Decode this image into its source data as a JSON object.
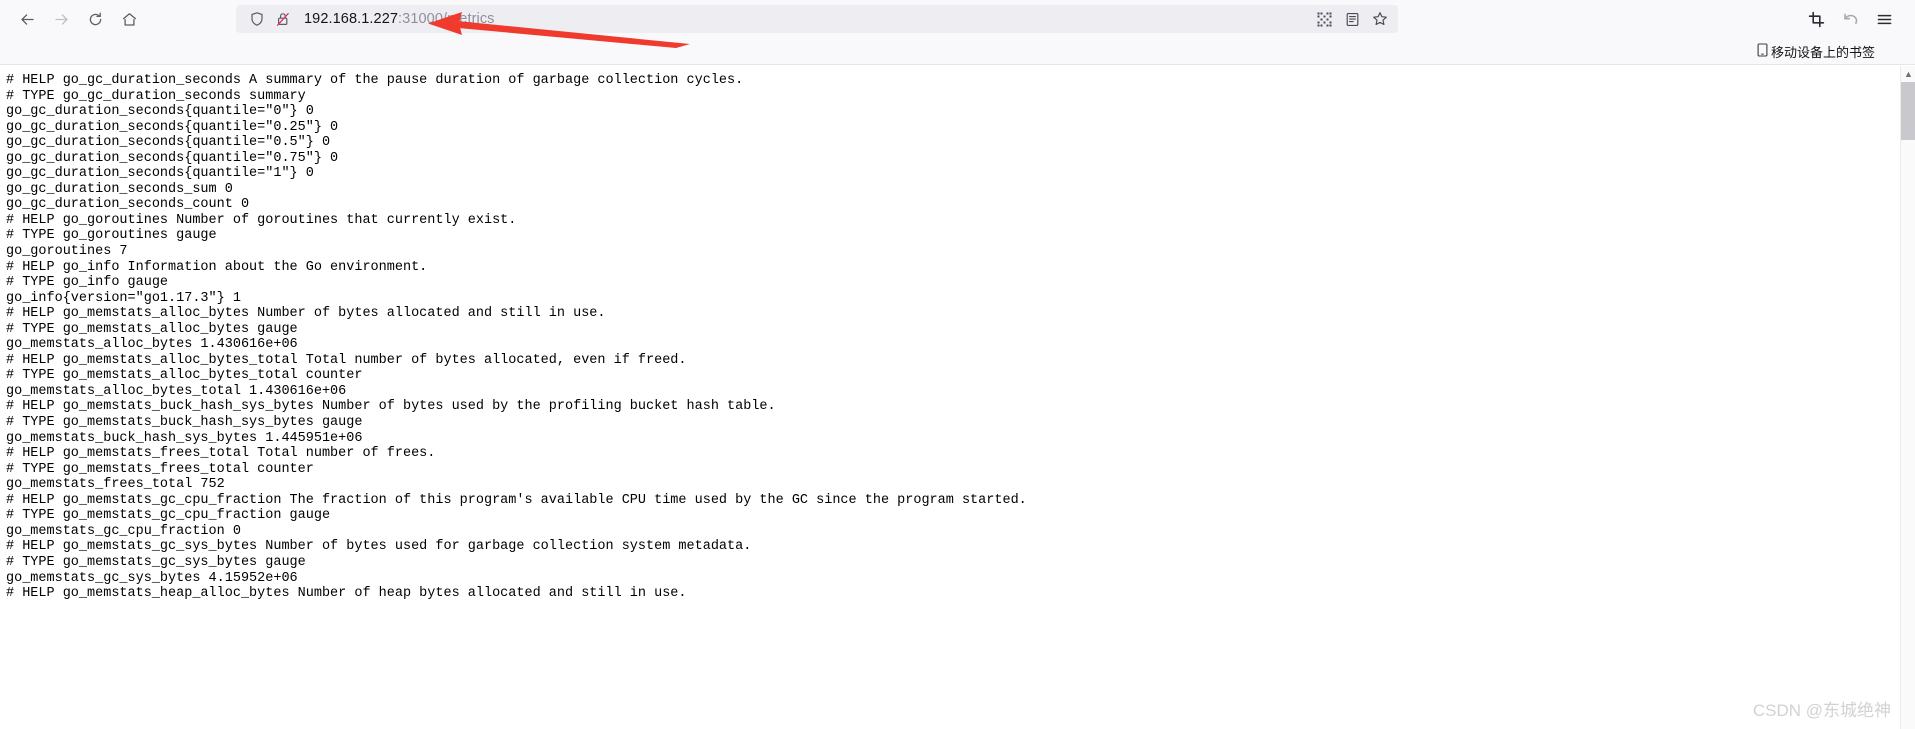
{
  "browser": {
    "back_label": "Back",
    "forward_label": "Forward",
    "reload_label": "Reload",
    "home_label": "Home",
    "url": {
      "host": "192.168.1.227",
      "rest": ":31000/metrics",
      "full": "192.168.1.227:31000/metrics",
      "shield_label": "Enhanced tracking protection",
      "lock_label": "Connection is not secure"
    },
    "url_actions": [
      {
        "name": "qr-code-icon",
        "label": "QR code"
      },
      {
        "name": "reader-mode-icon",
        "label": "Reader view"
      },
      {
        "name": "bookmark-star-icon",
        "label": "Bookmark this page"
      }
    ],
    "toolbar_right": [
      {
        "name": "screenshot-icon",
        "label": "Screenshot"
      },
      {
        "name": "undo-icon",
        "label": "Undo"
      },
      {
        "name": "menu-icon",
        "label": "Open application menu"
      }
    ]
  },
  "bookmarks_bar": {
    "items": [
      {
        "label": "移动设备上的书签",
        "icon": "mobile-device-icon"
      }
    ]
  },
  "scrollbar": {
    "up_arrow": "▲",
    "thumb_label": "Vertical scrollbar thumb"
  },
  "watermark": {
    "text": "CSDN @东城绝神"
  },
  "annotation": {
    "color": "#ef3b2d",
    "label": "Red arrow pointing at address bar URL"
  },
  "page": {
    "content_type": "prometheus-metrics-plaintext",
    "text": "# HELP go_gc_duration_seconds A summary of the pause duration of garbage collection cycles.\n# TYPE go_gc_duration_seconds summary\ngo_gc_duration_seconds{quantile=\"0\"} 0\ngo_gc_duration_seconds{quantile=\"0.25\"} 0\ngo_gc_duration_seconds{quantile=\"0.5\"} 0\ngo_gc_duration_seconds{quantile=\"0.75\"} 0\ngo_gc_duration_seconds{quantile=\"1\"} 0\ngo_gc_duration_seconds_sum 0\ngo_gc_duration_seconds_count 0\n# HELP go_goroutines Number of goroutines that currently exist.\n# TYPE go_goroutines gauge\ngo_goroutines 7\n# HELP go_info Information about the Go environment.\n# TYPE go_info gauge\ngo_info{version=\"go1.17.3\"} 1\n# HELP go_memstats_alloc_bytes Number of bytes allocated and still in use.\n# TYPE go_memstats_alloc_bytes gauge\ngo_memstats_alloc_bytes 1.430616e+06\n# HELP go_memstats_alloc_bytes_total Total number of bytes allocated, even if freed.\n# TYPE go_memstats_alloc_bytes_total counter\ngo_memstats_alloc_bytes_total 1.430616e+06\n# HELP go_memstats_buck_hash_sys_bytes Number of bytes used by the profiling bucket hash table.\n# TYPE go_memstats_buck_hash_sys_bytes gauge\ngo_memstats_buck_hash_sys_bytes 1.445951e+06\n# HELP go_memstats_frees_total Total number of frees.\n# TYPE go_memstats_frees_total counter\ngo_memstats_frees_total 752\n# HELP go_memstats_gc_cpu_fraction The fraction of this program's available CPU time used by the GC since the program started.\n# TYPE go_memstats_gc_cpu_fraction gauge\ngo_memstats_gc_cpu_fraction 0\n# HELP go_memstats_gc_sys_bytes Number of bytes used for garbage collection system metadata.\n# TYPE go_memstats_gc_sys_bytes gauge\ngo_memstats_gc_sys_bytes 4.15952e+06\n# HELP go_memstats_heap_alloc_bytes Number of heap bytes allocated and still in use."
  }
}
